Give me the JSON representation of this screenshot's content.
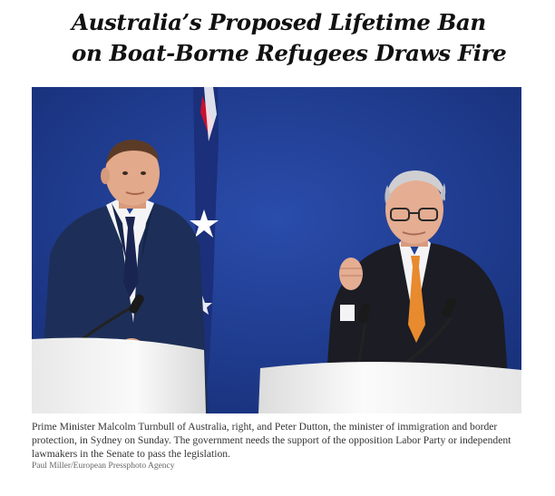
{
  "article": {
    "headline_line1": "Australia’s Proposed Lifetime Ban",
    "headline_line2": "on Boat-Borne Refugees Draws Fire",
    "photo": {
      "subject": "press-conference-photo",
      "colors": {
        "backdrop": "#1f3d93",
        "suit": "#1c2d52",
        "skin": "#e2a98a",
        "tie_orange": "#e88a2e",
        "tie_navy": "#1a2450",
        "podium": "#f2f2f2"
      }
    },
    "caption": "Prime Minister Malcolm Turnbull of Australia, right, and Peter Dutton, the minister of immigration and border protection, in Sydney on Sunday. The government needs the support of the opposition Labor Party or independent lawmakers in the Senate to pass the legislation.",
    "credit": "Paul Miller/European Pressphoto Agency"
  }
}
